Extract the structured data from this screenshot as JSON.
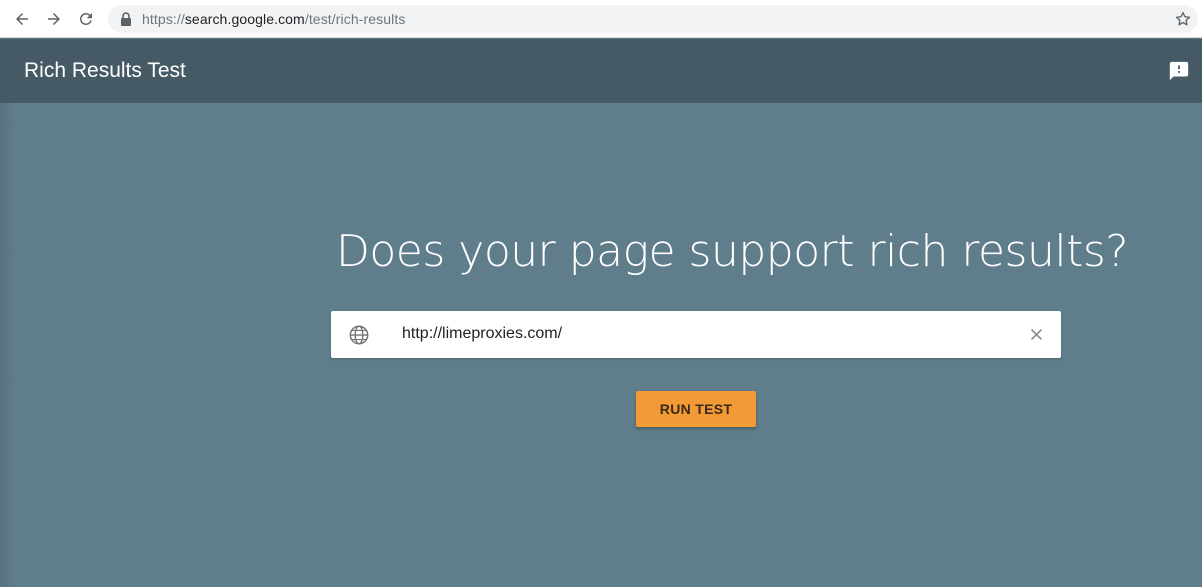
{
  "browser": {
    "url_prefix": "https://",
    "url_host": "search.google.com",
    "url_path": "/test/rich-results"
  },
  "header": {
    "title": "Rich Results Test"
  },
  "main": {
    "headline": "Does your page support rich results?",
    "url_value": "http://limeproxies.com/",
    "run_button_label": "RUN TEST"
  },
  "icons": {
    "back": "arrow-back-icon",
    "forward": "arrow-forward-icon",
    "reload": "reload-icon",
    "lock": "lock-icon",
    "star": "star-icon",
    "feedback": "feedback-icon",
    "globe": "globe-icon",
    "clear": "close-icon"
  },
  "colors": {
    "header_bg": "#455a64",
    "main_bg": "#607d8b",
    "button_bg": "#f29a36"
  }
}
